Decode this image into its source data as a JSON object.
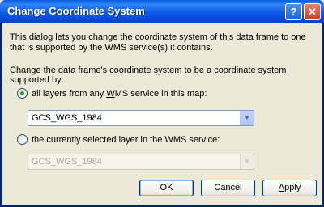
{
  "window": {
    "title": "Change Coordinate System",
    "help_glyph": "?",
    "close_glyph": "✕"
  },
  "description": "This dialog lets you change the coordinate system of this data frame to one that is supported by the WMS service(s) it contains.",
  "prompt": "Change the data frame's coordinate system to be a coordinate system supported by:",
  "options": {
    "all_layers": {
      "label_before": "all layers from any ",
      "label_mnemonic": "W",
      "label_after": "MS service in this map:",
      "selected": true,
      "combo_value": "GCS_WGS_1984"
    },
    "selected_layer": {
      "label": "the currently selected layer in the WMS service:",
      "selected": false,
      "combo_value": "GCS_WGS_1984"
    }
  },
  "buttons": {
    "ok": "OK",
    "cancel": "Cancel",
    "apply_mnemonic": "A",
    "apply_rest": "pply"
  }
}
